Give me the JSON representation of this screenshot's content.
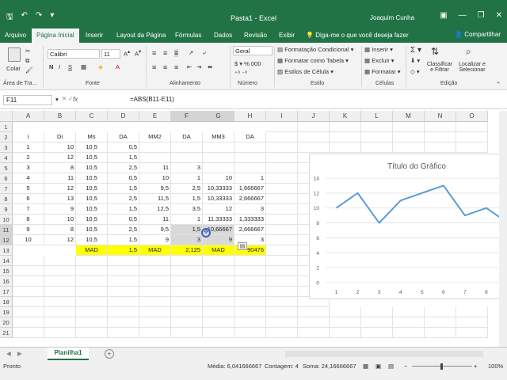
{
  "titlebar": {
    "doc_title": "Pasta1 - Excel",
    "user": "Joaquim Cunha"
  },
  "tabs": [
    {
      "label": "Arquivo",
      "active": false
    },
    {
      "label": "Página Inicial",
      "active": true
    },
    {
      "label": "Inserir",
      "active": false
    },
    {
      "label": "Layout da Página",
      "active": false
    },
    {
      "label": "Fórmulas",
      "active": false
    },
    {
      "label": "Dados",
      "active": false
    },
    {
      "label": "Revisão",
      "active": false
    },
    {
      "label": "Exibir",
      "active": false
    }
  ],
  "tell_me": "Diga-me o que você deseja fazer",
  "share": "Compartilhar",
  "ribbon": {
    "paste": "Colar",
    "clipboard": "Área de Tra...",
    "font_name": "Calibri",
    "font_size": "11",
    "font_group": "Fonte",
    "align_group": "Alinhamento",
    "number_format": "Geral",
    "number_group": "Número",
    "cond_format": "Formatação Condicional",
    "format_table": "Formatar como Tabela",
    "cell_styles": "Estilos de Célula",
    "styles_group": "Estilo",
    "insert": "Inserir",
    "delete": "Excluir",
    "format": "Formatar",
    "cells_group": "Células",
    "sort": "Classificar e Filtrar",
    "find": "Localizar e Selecionar",
    "edit_group": "Edição"
  },
  "formula_bar": {
    "name_box": "F11",
    "fx": "fx",
    "formula": "=ABS(B11-E11)"
  },
  "columns": [
    "A",
    "B",
    "C",
    "D",
    "E",
    "F",
    "G",
    "H",
    "I",
    "J",
    "K",
    "L",
    "M",
    "N",
    "O"
  ],
  "rows": [
    "1",
    "2",
    "3",
    "4",
    "5",
    "6",
    "7",
    "8",
    "9",
    "10",
    "11",
    "12",
    "13",
    "14",
    "15",
    "16",
    "17",
    "18",
    "19",
    "20",
    "21"
  ],
  "sheet": {
    "header_row": [
      "i",
      "Di",
      "Ms",
      "DA",
      "MM2",
      "DA",
      "MM3",
      "DA"
    ],
    "data": [
      [
        "1",
        "10",
        "10,5",
        "0,5",
        "",
        "",
        "",
        ""
      ],
      [
        "2",
        "12",
        "10,5",
        "1,5",
        "",
        "",
        "",
        ""
      ],
      [
        "3",
        "8",
        "10,5",
        "2,5",
        "11",
        "3",
        "",
        ""
      ],
      [
        "4",
        "11",
        "10,5",
        "0,5",
        "10",
        "1",
        "10",
        "1"
      ],
      [
        "5",
        "12",
        "10,5",
        "1,5",
        "9,5",
        "2,5",
        "10,33333",
        "1,666667"
      ],
      [
        "6",
        "13",
        "10,5",
        "2,5",
        "11,5",
        "1,5",
        "10,33333",
        "2,666667"
      ],
      [
        "7",
        "9",
        "10,5",
        "1,5",
        "12,5",
        "3,5",
        "12",
        "3"
      ],
      [
        "8",
        "10",
        "10,5",
        "0,5",
        "11",
        "1",
        "11,33333",
        "1,333333"
      ],
      [
        "9",
        "8",
        "10,5",
        "2,5",
        "9,5",
        "1,5",
        "10,66667",
        "2,666667"
      ],
      [
        "10",
        "12",
        "10,5",
        "1,5",
        "9",
        "3",
        "9",
        "3"
      ]
    ],
    "mad_row": [
      "MAD",
      "1,5",
      "MAD",
      "2,125",
      "MAD",
      "90476"
    ]
  },
  "chart_data": {
    "type": "line",
    "title": "Título do Gráfico",
    "x": [
      1,
      2,
      3,
      4,
      5,
      6,
      7,
      8,
      9
    ],
    "series": [
      {
        "values": [
          10,
          12,
          8,
          11,
          12,
          13,
          9,
          10,
          8
        ]
      }
    ],
    "ylim": [
      0,
      14
    ],
    "yticks": [
      "0",
      "2",
      "4",
      "6",
      "8",
      "10",
      "12",
      "14"
    ],
    "xticks": [
      "1",
      "2",
      "3",
      "4",
      "5",
      "6",
      "7",
      "8"
    ],
    "line_color": "#5b9bd5",
    "grid": true
  },
  "sheet_tab": "Planilha1",
  "status": {
    "ready": "Pronto",
    "average": "Média: 6,041666667",
    "count": "Contagem: 4",
    "sum": "Soma: 24,16666667",
    "zoom": "100%"
  },
  "colors": {
    "excel_green": "#217346",
    "highlight": "#ffff00"
  }
}
